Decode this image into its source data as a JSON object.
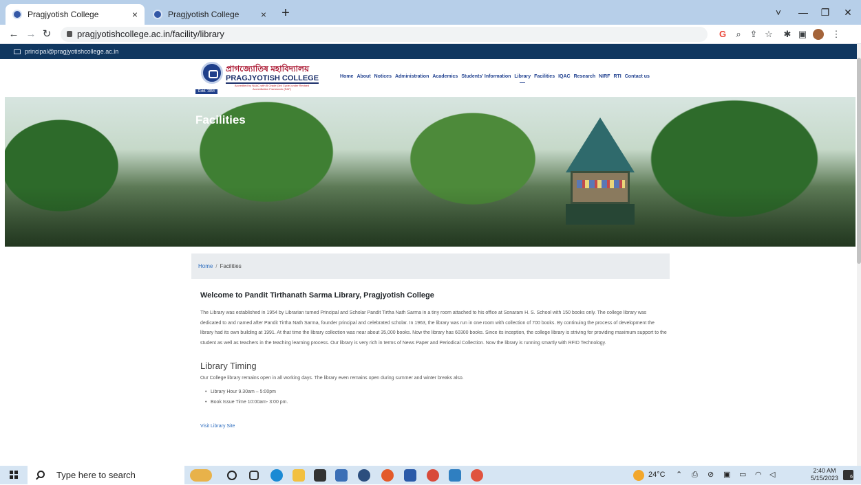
{
  "browser": {
    "tabs": [
      {
        "title": "Pragjyotish College",
        "active": true
      },
      {
        "title": "Pragjyotish College",
        "active": false
      }
    ],
    "close_glyph": "×",
    "new_tab_glyph": "+",
    "url": "pragjyotishcollege.ac.in/facility/library",
    "window_controls": [
      "˅",
      "—",
      "❐",
      "✕"
    ],
    "icons": [
      "google-icon",
      "zoom-icon",
      "share-icon",
      "bookmark-star-icon",
      "extensions-icon",
      "sidepanel-icon",
      "profile-avatar",
      "menu-icon"
    ]
  },
  "site": {
    "email": "principal@pragjyotishcollege.ac.in",
    "logo": {
      "bengali": "প্ৰাগজ্যোতিষ মহাবিদ্যালয়",
      "english": "PRAGJYOTISH COLLEGE",
      "tagline": "Accredited by NAAC with B Grade (3rd Cycle) under Revised Accreditation Framework (RAF)",
      "estd": "Estd. 1954"
    },
    "nav": [
      "Home",
      "About",
      "Notices",
      "Administration",
      "Academics",
      "Students' Information",
      "Library",
      "Facilities",
      "IQAC",
      "Research",
      "NIRF",
      "RTI",
      "Contact us"
    ],
    "active_nav": "Library",
    "hero_title": "Facilities",
    "breadcrumb": {
      "home": "Home",
      "separator": "/",
      "current": "Facilities"
    },
    "heading": "Welcome to Pandit Tirthanath Sarma Library, Pragjyotish College",
    "paragraph": "The Library was established in 1954 by Librarian turned Principal and Scholar Pandit Tirtha Nath Sarma in a tiny room attached to his office at Sonaram H. S. School with 150 books only. The college library was dedicated to and named after Pandit Tirtha Nath Sarma, founder principal and celebrated scholar. In 1963, the library was run in one room with collection of 700 books. By continuing the process of development the library had its own building at 1991. At that time the library collection was near about 35,000 books. Now the library has 60300 books. Since its inception, the college library is striving for providing maximum support to the student as well as teachers in the teaching learning process. Our library is very rich in terms of News Paper and Periodical Collection. Now the library is running smartly with RFID Technology.",
    "timing_heading": "Library Timing",
    "timing_text": "Our College library remains open in all working days. The library even remains open during summer and winter breaks also.",
    "timing_list": [
      "Library Hour 9.30am – 5:00pm",
      "Book Issue Time 10:00am- 3:00 pm."
    ],
    "visit_link": "Visit Library Site"
  },
  "taskbar": {
    "search_placeholder": "Type here to search",
    "weather": "24°C",
    "time": "2:40 AM",
    "date": "5/15/2023",
    "notification_count": "6",
    "icons": [
      "task-view-icon",
      "cortana-icon",
      "edge-icon",
      "file-explorer-icon",
      "store-icon",
      "mail-icon",
      "search-app-icon",
      "chrome-icon",
      "word-icon",
      "chrome-profile-icon",
      "photos-icon",
      "chrome-alt-icon"
    ]
  }
}
